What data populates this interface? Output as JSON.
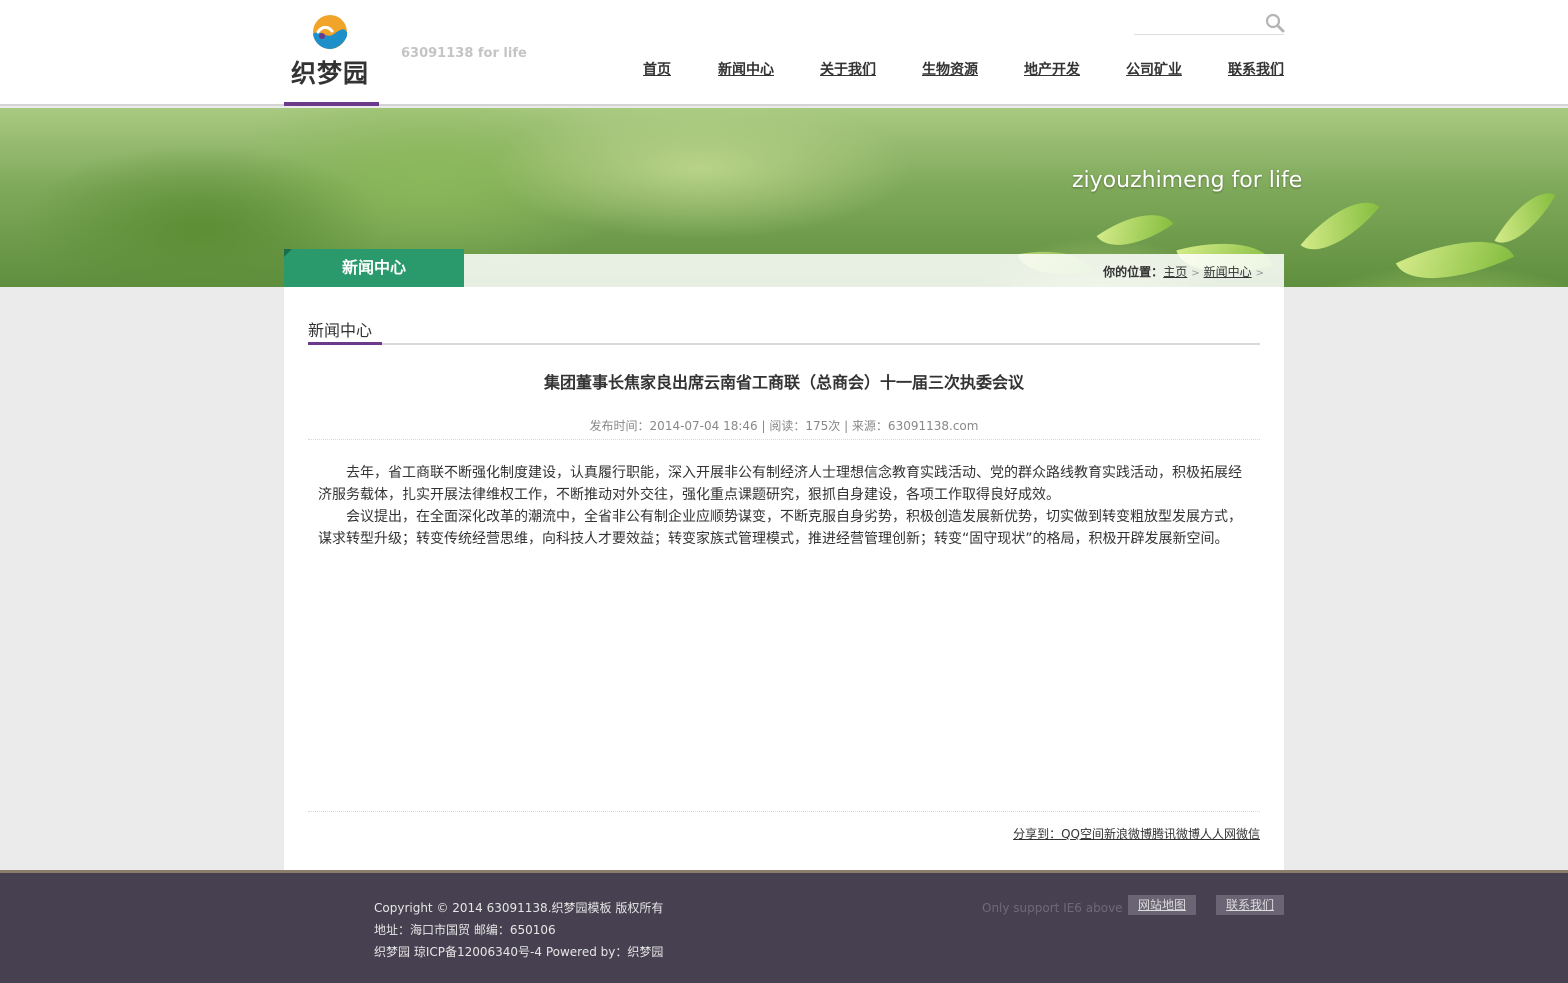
{
  "header": {
    "logo_text": "织梦园",
    "tagline": "63091138 for life",
    "search_placeholder": "",
    "nav": [
      "首页",
      "新闻中心",
      "关于我们",
      "生物资源",
      "地产开发",
      "公司矿业",
      "联系我们"
    ]
  },
  "banner": {
    "slogan": "ziyouzhimeng for life",
    "section_tab": "新闻中心",
    "breadcrumb": {
      "label": "你的位置：",
      "items": [
        "主页",
        "新闻中心"
      ],
      "separator": ">"
    }
  },
  "main": {
    "section_title": "新闻中心",
    "article": {
      "title": "集团董事长焦家良出席云南省工商联（总商会）十一届三次执委会议",
      "meta": "发布时间：2014-07-04 18:46 | 阅读：175次 | 来源：63091138.com",
      "paragraphs": [
        "去年，省工商联不断强化制度建设，认真履行职能，深入开展非公有制经济人士理想信念教育实践活动、党的群众路线教育实践活动，积极拓展经济服务载体，扎实开展法律维权工作，不断推动对外交往，强化重点课题研究，狠抓自身建设，各项工作取得良好成效。",
        "会议提出，在全面深化改革的潮流中，全省非公有制企业应顺势谋变，不断克服自身劣势，积极创造发展新优势，切实做到转变粗放型发展方式，谋求转型升级；转变传统经营思维，向科技人才要效益；转变家族式管理模式，推进经营管理创新；转变“固守现状”的格局，积极开辟发展新空间。"
      ]
    },
    "share_text": "分享到：QQ空间新浪微博腾讯微博人人网微信"
  },
  "footer": {
    "lines": [
      "Copyright © 2014 63091138.织梦园模板 版权所有",
      "地址：海口市国贸 邮编：650106",
      "织梦园 琼ICP备12006340号-4    Powered by：织梦园"
    ],
    "ie_note": "Only support IE6 above",
    "buttons": [
      "网站地图",
      "联系我们"
    ]
  },
  "colors": {
    "accent_purple": "#6b3a8a",
    "tab_green": "#2a9a6c",
    "footer_bg": "#464050"
  }
}
